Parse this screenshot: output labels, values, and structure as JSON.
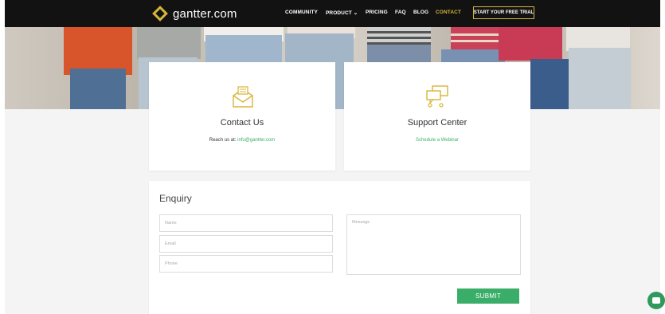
{
  "brand": {
    "name": "gantter.com"
  },
  "nav": {
    "items": [
      {
        "label": "COMMUNITY"
      },
      {
        "label": "PRODUCT ⌄"
      },
      {
        "label": "PRICING"
      },
      {
        "label": "FAQ"
      },
      {
        "label": "BLOG"
      },
      {
        "label": "CONTACT"
      }
    ],
    "cta": "START YOUR FREE TRIAL"
  },
  "cards": {
    "contact": {
      "title": "Contact Us",
      "text": "Reach us at:",
      "email": "info@gantter.com",
      "icon": "mail-icon"
    },
    "support": {
      "title": "Support Center",
      "link": "Schedule a Webinar",
      "icon": "chat-bubbles-icon"
    }
  },
  "enquiry": {
    "title": "Enquiry",
    "name_placeholder": "Name",
    "email_placeholder": "Email",
    "phone_placeholder": "Phone",
    "message_placeholder": "Message",
    "submit": "SUBMIT"
  },
  "colors": {
    "accent": "#d9b537",
    "green": "#3aae68",
    "nav_bg": "#121212"
  }
}
